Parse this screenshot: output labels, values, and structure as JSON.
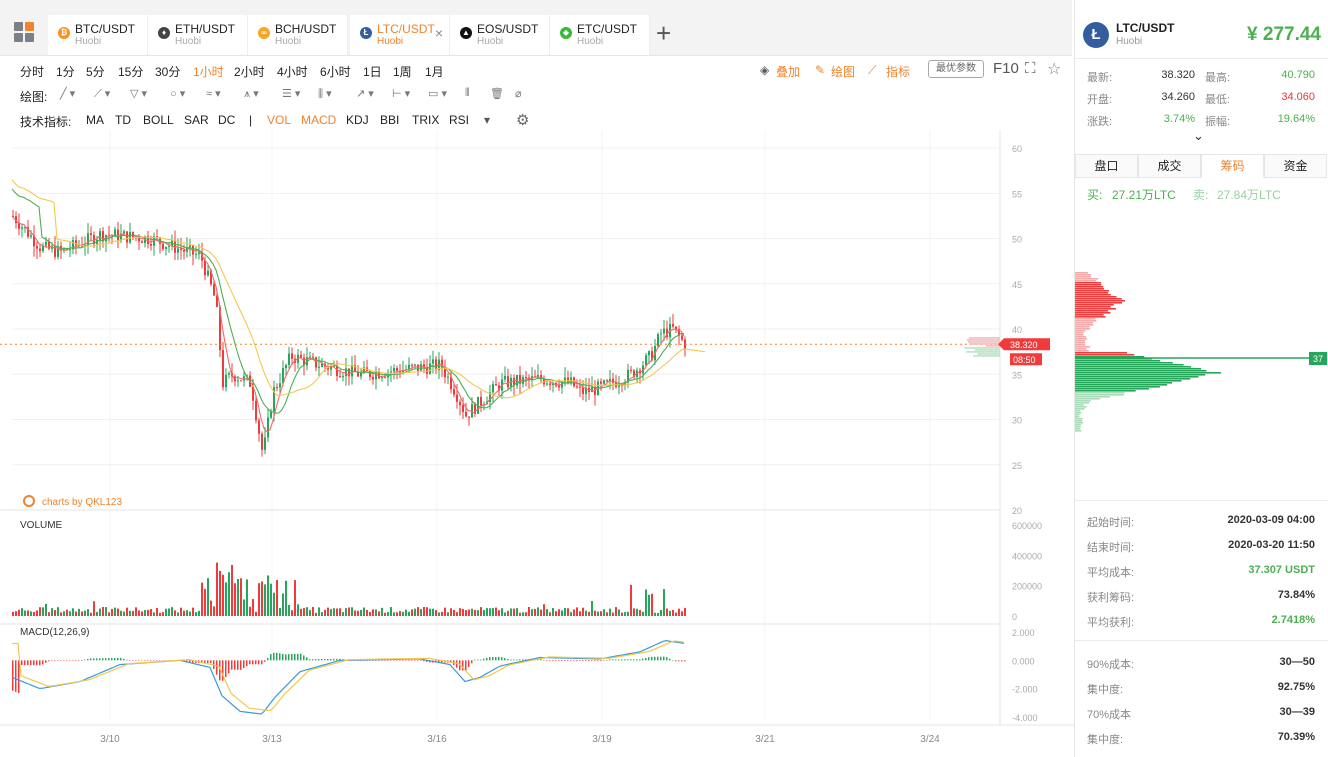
{
  "tabs": [
    {
      "pair": "BTC/USDT",
      "ex": "Huobi",
      "color": "#f7931a",
      "glyph": "₿",
      "active": false
    },
    {
      "pair": "ETH/USDT",
      "ex": "Huobi",
      "color": "#444",
      "glyph": "♦",
      "active": false
    },
    {
      "pair": "BCH/USDT",
      "ex": "Huobi",
      "color": "#f5a623",
      "glyph": "∞",
      "active": false
    },
    {
      "pair": "LTC/USDT",
      "ex": "Huobi",
      "color": "#345d9d",
      "glyph": "Ł",
      "active": true
    },
    {
      "pair": "EOS/USDT",
      "ex": "Huobi",
      "color": "#111",
      "glyph": "▲",
      "active": false
    },
    {
      "pair": "ETC/USDT",
      "ex": "Huobi",
      "color": "#3ab83a",
      "glyph": "◆",
      "active": false
    }
  ],
  "timeframes": [
    "分时",
    "1分",
    "5分",
    "15分",
    "30分",
    "1小时",
    "2小时",
    "4小时",
    "6小时",
    "1日",
    "1周",
    "1月"
  ],
  "active_timeframe": "1小时",
  "tools": {
    "overlay": "叠加",
    "draw": "绘图",
    "indicator": "指标",
    "params": "最优参数",
    "f10": "F10"
  },
  "draw_label": "绘图:",
  "indicators_label": "技术指标:",
  "indicators": [
    "MA",
    "TD",
    "BOLL",
    "SAR",
    "DC",
    "|",
    "VOL",
    "MACD",
    "KDJ",
    "BBI",
    "TRIX",
    "RSI"
  ],
  "active_indicators": [
    "VOL",
    "MACD"
  ],
  "watermark": "charts by QKL123",
  "volume_label": "VOLUME",
  "macd_label": "MACD(12,26,9)",
  "price_marker": {
    "price": "38.320",
    "time": "08:50"
  },
  "chart_data": {
    "type": "candlestick",
    "x_ticks": [
      "3/10",
      "3/13",
      "3/16",
      "3/19",
      "3/21",
      "3/24"
    ],
    "y_ticks": [
      "60",
      "55",
      "50",
      "45",
      "40",
      "35",
      "30",
      "25",
      "20"
    ],
    "ylim": [
      20,
      62
    ],
    "volume_ticks": [
      "600000",
      "400000",
      "200000",
      "0"
    ],
    "macd_ticks": [
      "2.000",
      "0.000",
      "-2.000",
      "-4.000"
    ],
    "last_price": 38.32
  },
  "panel": {
    "pair": "LTC/USDT",
    "ex": "Huobi",
    "price": "¥ 277.44",
    "stats": [
      {
        "l": "最新:",
        "v": "38.320",
        "c": "#333",
        "l2": "最高:",
        "v2": "40.790",
        "c2": "#4caf50"
      },
      {
        "l": "开盘:",
        "v": "34.260",
        "c": "#333",
        "l2": "最低:",
        "v2": "34.060",
        "c2": "#e53935"
      },
      {
        "l": "涨跌:",
        "v": "3.74%",
        "c": "#4caf50",
        "l2": "振幅:",
        "v2": "19.64%",
        "c2": "#4caf50"
      }
    ],
    "tabs": [
      "盘口",
      "成交",
      "筹码",
      "资金"
    ],
    "active_tab": "筹码",
    "buy_label": "买:",
    "buy": "27.21万LTC",
    "sell_label": "卖:",
    "sell": "27.84万LTC",
    "cost_marker": "37",
    "info1": [
      {
        "l": "起始时间:",
        "v": "2020-03-09 04:00",
        "c": "#333"
      },
      {
        "l": "结束时间:",
        "v": "2020-03-20 11:50",
        "c": "#333"
      },
      {
        "l": "平均成本:",
        "v": "37.307 USDT",
        "c": "#4caf50"
      },
      {
        "l": "获利筹码:",
        "v": "73.84%",
        "c": "#333"
      },
      {
        "l": "平均获利:",
        "v": "2.7418%",
        "c": "#4caf50"
      }
    ],
    "info2": [
      {
        "l": "90%成本:",
        "v": "30—50",
        "c": "#333"
      },
      {
        "l": "集中度:",
        "v": "92.75%",
        "c": "#333"
      },
      {
        "l": "70%成本",
        "v": "30—39",
        "c": "#333"
      },
      {
        "l": "集中度:",
        "v": "70.39%",
        "c": "#333"
      }
    ]
  }
}
